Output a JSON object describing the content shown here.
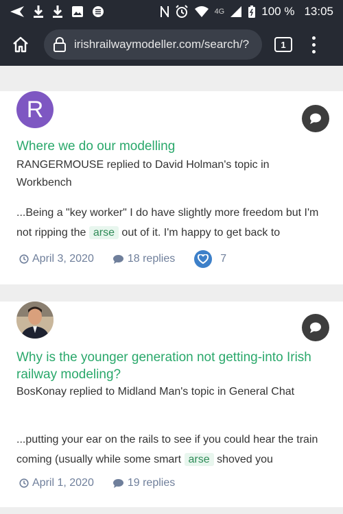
{
  "status_bar": {
    "network": "4G",
    "battery": "100 %",
    "time": "13:05"
  },
  "browser": {
    "url": "irishrailwaymodeller.com/search/?",
    "tab_count": "1"
  },
  "results": [
    {
      "avatar_letter": "R",
      "title": "Where we do our modelling",
      "meta": "RANGERMOUSE replied to David Holman's topic in Workbench",
      "snippet_before": "...Being a \"key worker\" I do have slightly more freedom but I'm not ripping the ",
      "snippet_highlight": "arse",
      "snippet_after": " out of it. I'm happy to get back to",
      "date": "April 3, 2020",
      "replies": "18 replies",
      "likes": "7"
    },
    {
      "title": "Why is the younger generation not getting-into Irish railway modeling?",
      "meta": "BosKonay replied to Midland Man's topic in General Chat",
      "snippet_before": "...putting your ear on the rails to see if you could hear the train coming (usually while some smart ",
      "snippet_highlight": "arse",
      "snippet_after": " shoved you",
      "date": "April 1, 2020",
      "replies": "19 replies"
    }
  ],
  "icons": [
    "home-icon",
    "lock-icon",
    "tabs-icon",
    "more-vert-icon",
    "chat-bubble-icon",
    "clock-icon",
    "comment-icon",
    "heart-icon"
  ],
  "colors": {
    "link": "#2aa86b",
    "toolbar": "#262a33",
    "avatar_r": "#7e57c2",
    "like": "#3d80c9"
  }
}
